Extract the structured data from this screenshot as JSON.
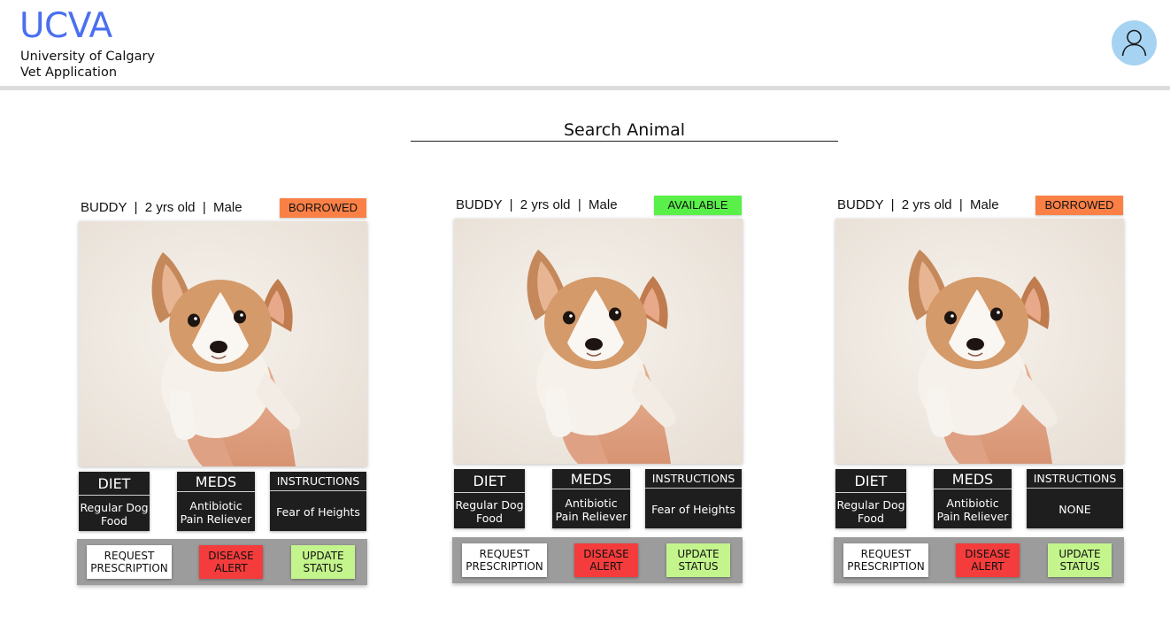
{
  "header": {
    "logo": "UCVA",
    "subtitle_line1": "University of Calgary",
    "subtitle_line2": "Vet Application",
    "avatar_icon": "user-icon"
  },
  "search": {
    "placeholder": "Search Animal"
  },
  "colors": {
    "brand": "#4a6ff0",
    "borrowed": "#fb8046",
    "available": "#5af04a",
    "disease_alert": "#f53c3c",
    "update_status": "#c4f58c",
    "info_box": "#1e1e1e",
    "action_bar": "#9c9c9c"
  },
  "cards": [
    {
      "title": "BUDDY  |  2 yrs old  |  Male",
      "status": "BORROWED",
      "status_color": "#fb8046",
      "diet_label": "DIET",
      "diet_value_1": "Regular Dog",
      "diet_value_2": "Food",
      "meds_label": "MEDS",
      "meds_value_1": "Antibiotic",
      "meds_value_2": "Pain Reliever",
      "instructions_label": "INSTRUCTIONS",
      "instructions_value": "Fear of Heights",
      "request_line1": "REQUEST",
      "request_line2": "PRESCRIPTION",
      "alert_line1": "DISEASE",
      "alert_line2": "ALERT",
      "update_line1": "UPDATE",
      "update_line2": "STATUS"
    },
    {
      "title": "BUDDY  |  2 yrs old  |  Male",
      "status": "AVAILABLE",
      "status_color": "#5af04a",
      "diet_label": "DIET",
      "diet_value_1": "Regular Dog",
      "diet_value_2": "Food",
      "meds_label": "MEDS",
      "meds_value_1": "Antibiotic",
      "meds_value_2": "Pain Reliever",
      "instructions_label": "INSTRUCTIONS",
      "instructions_value": "Fear of Heights",
      "request_line1": "REQUEST",
      "request_line2": "PRESCRIPTION",
      "alert_line1": "DISEASE",
      "alert_line2": "ALERT",
      "update_line1": "UPDATE",
      "update_line2": "STATUS"
    },
    {
      "title": "BUDDY  |  2 yrs old  |  Male",
      "status": "BORROWED",
      "status_color": "#fb8046",
      "diet_label": "DIET",
      "diet_value_1": "Regular Dog",
      "diet_value_2": "Food",
      "meds_label": "MEDS",
      "meds_value_1": "Antibiotic",
      "meds_value_2": "Pain Reliever",
      "instructions_label": "INSTRUCTIONS",
      "instructions_value": "NONE",
      "request_line1": "REQUEST",
      "request_line2": "PRESCRIPTION",
      "alert_line1": "DISEASE",
      "alert_line2": "ALERT",
      "update_line1": "UPDATE",
      "update_line2": "STATUS"
    }
  ]
}
